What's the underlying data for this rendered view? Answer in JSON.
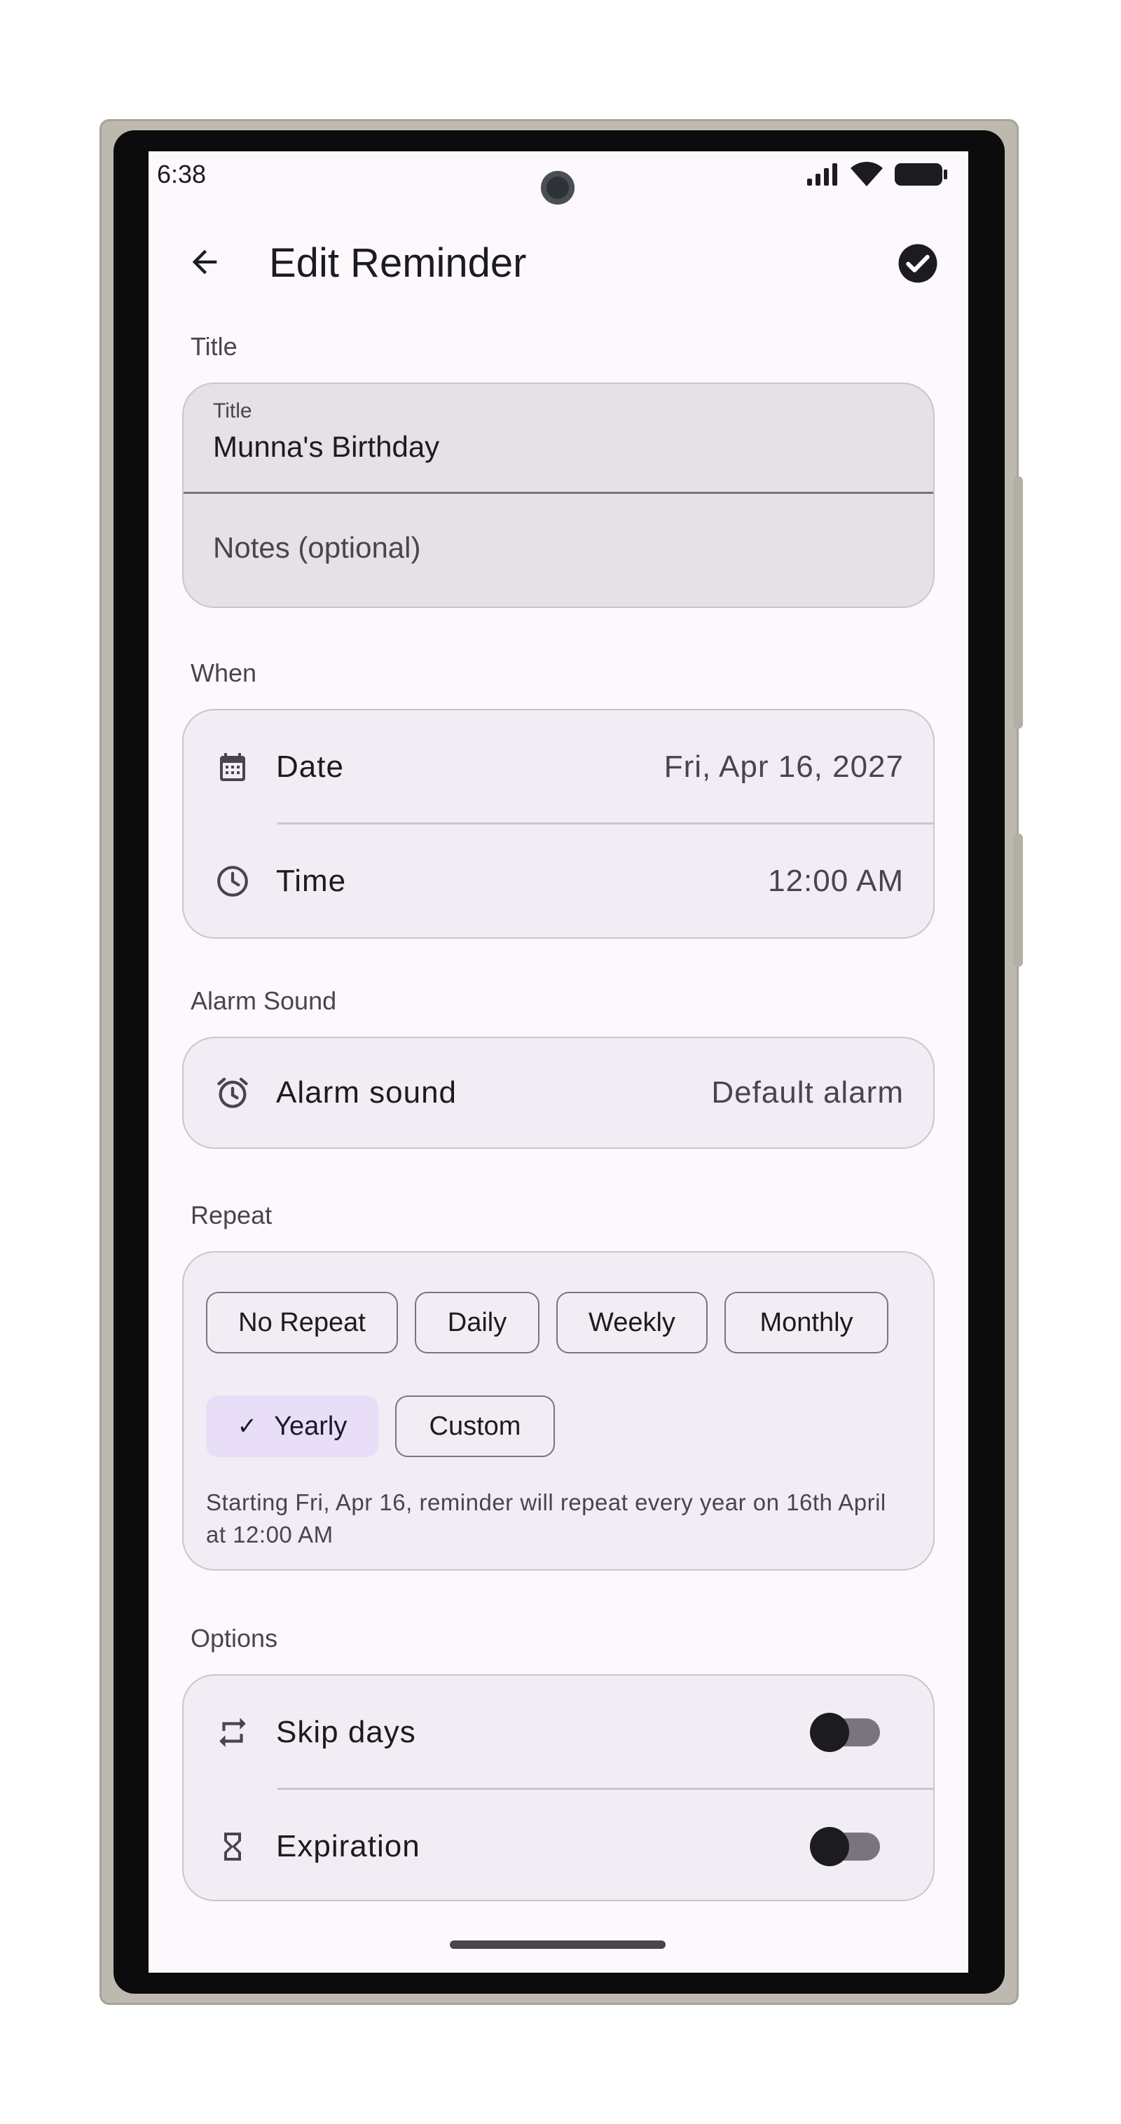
{
  "status_bar": {
    "time": "6:38"
  },
  "app_bar": {
    "title": "Edit Reminder"
  },
  "title_section": {
    "heading": "Title",
    "title_field": {
      "label": "Title",
      "value": "Munna's Birthday"
    },
    "notes_field": {
      "placeholder": "Notes (optional)"
    }
  },
  "when_section": {
    "heading": "When",
    "date": {
      "label": "Date",
      "value": "Fri, Apr 16, 2027"
    },
    "time": {
      "label": "Time",
      "value": "12:00 AM"
    }
  },
  "alarm_section": {
    "heading": "Alarm Sound",
    "alarm": {
      "label": "Alarm sound",
      "value": "Default alarm"
    }
  },
  "repeat_section": {
    "heading": "Repeat",
    "chips": [
      {
        "label": "No Repeat",
        "selected": false
      },
      {
        "label": "Daily",
        "selected": false
      },
      {
        "label": "Weekly",
        "selected": false
      },
      {
        "label": "Monthly",
        "selected": false
      },
      {
        "label": "Yearly",
        "selected": true
      },
      {
        "label": "Custom",
        "selected": false
      }
    ],
    "description": "Starting Fri, Apr 16, reminder will repeat every year on 16th April at 12:00 AM"
  },
  "options_section": {
    "heading": "Options",
    "skip_days": {
      "label": "Skip days",
      "enabled": false
    },
    "expiration": {
      "label": "Expiration",
      "enabled": false
    }
  },
  "colors": {
    "background": "#fdf8fc",
    "card": "#f2ecf4",
    "selected_chip": "#e8def8",
    "text_primary": "#1c1b1f",
    "text_secondary": "#49454f"
  },
  "icons": [
    "back-arrow-icon",
    "check-circle-icon",
    "calendar-icon",
    "clock-icon",
    "alarm-clock-icon",
    "repeat-icon",
    "hourglass-icon",
    "signal-icon",
    "wifi-icon",
    "battery-icon"
  ]
}
